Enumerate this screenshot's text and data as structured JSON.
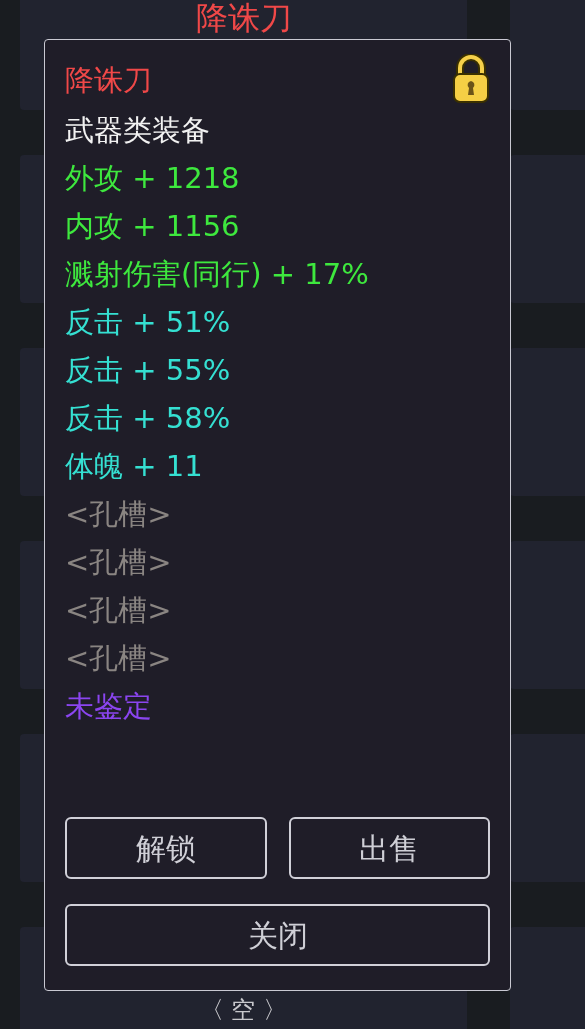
{
  "background": {
    "top_card_title": "降诛刀",
    "bottom_card_label": "〈 空 〉"
  },
  "item_panel": {
    "locked": true,
    "lines": [
      {
        "kind": "name",
        "text": "降诛刀"
      },
      {
        "kind": "category",
        "text": "武器类装备"
      },
      {
        "kind": "base_stat",
        "text": "外攻 + 1218"
      },
      {
        "kind": "base_stat",
        "text": "内攻 + 1156"
      },
      {
        "kind": "base_stat",
        "text": "溅射伤害(同行) + 17%"
      },
      {
        "kind": "bonus_stat",
        "text": "反击 + 51%"
      },
      {
        "kind": "bonus_stat",
        "text": "反击 + 55%"
      },
      {
        "kind": "bonus_stat",
        "text": "反击 + 58%"
      },
      {
        "kind": "bonus_stat",
        "text": "体魄 + 11"
      },
      {
        "kind": "socket",
        "text": "<孔槽>"
      },
      {
        "kind": "socket",
        "text": "<孔槽>"
      },
      {
        "kind": "socket",
        "text": "<孔槽>"
      },
      {
        "kind": "socket",
        "text": "<孔槽>"
      },
      {
        "kind": "unidentified",
        "text": "未鉴定"
      }
    ],
    "buttons": [
      {
        "label": "解锁"
      },
      {
        "label": "出售"
      },
      {
        "label": "关闭"
      }
    ]
  }
}
